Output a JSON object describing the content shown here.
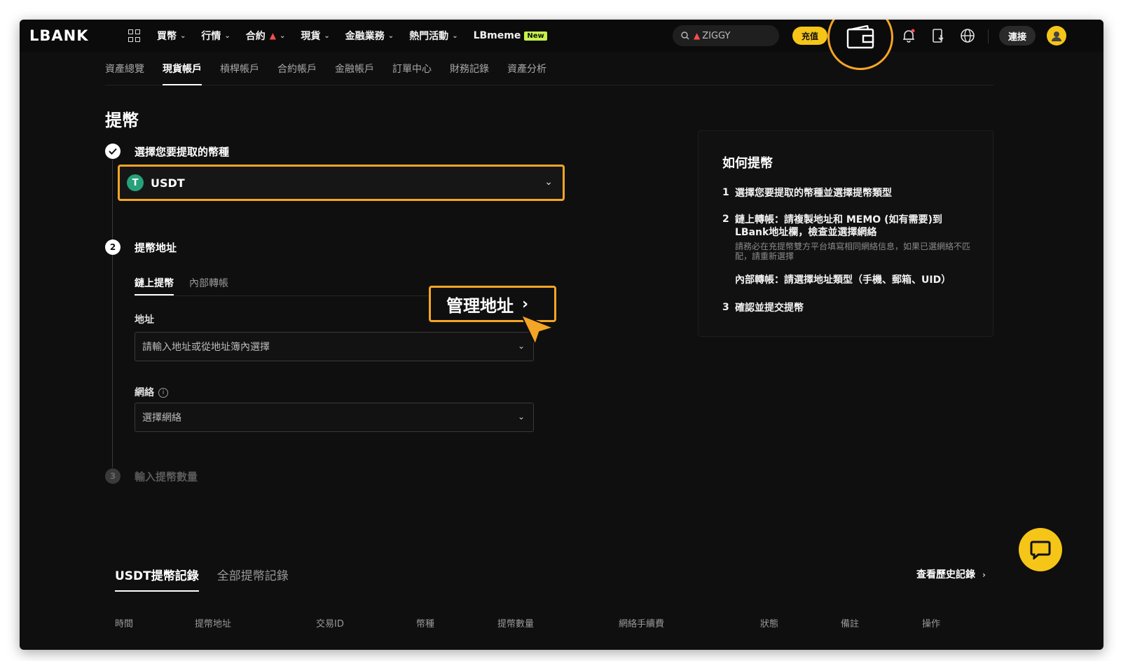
{
  "brand": {
    "logo": "LBANK",
    "accent": "#f5a524",
    "yellow": "#f5c518"
  },
  "topnav": {
    "items": [
      {
        "label": "買幣",
        "has_chevron": true
      },
      {
        "label": "行情",
        "has_chevron": true
      },
      {
        "label": "合約",
        "has_chevron": true,
        "hot": true
      },
      {
        "label": "現貨",
        "has_chevron": true
      },
      {
        "label": "金融業務",
        "has_chevron": true
      },
      {
        "label": "熱門活動",
        "has_chevron": true
      },
      {
        "label": "LBmeme",
        "badge": "New"
      }
    ],
    "search_text": "ZIGGY",
    "deposit_label": "充值",
    "connect_label": "連接",
    "icons": [
      "apps-grid-icon",
      "wallet-icon",
      "bell-icon",
      "download-app-icon",
      "globe-icon",
      "avatar"
    ]
  },
  "subnav": {
    "tabs": [
      "資產總覽",
      "現貨帳戶",
      "槓桿帳戶",
      "合約帳戶",
      "金融帳戶",
      "訂單中心",
      "財務記錄",
      "資產分析"
    ],
    "active_index": 1
  },
  "page": {
    "title": "提幣"
  },
  "steps": {
    "step1": {
      "title": "選擇您要提取的幣種",
      "coin_symbol": "T",
      "coin_name": "USDT",
      "done": true
    },
    "step2": {
      "number": "2",
      "title": "提幣地址",
      "tabs": [
        "鏈上提幣",
        "內部轉帳"
      ],
      "address_label": "地址",
      "address_placeholder": "請輸入地址或從地址簿內選擇",
      "network_label": "網絡",
      "network_placeholder": "選擇網絡",
      "manage_address_label": "管理地址"
    },
    "step3": {
      "number": "3",
      "title": "輸入提幣數量"
    }
  },
  "howto": {
    "title": "如何提幣",
    "items": [
      {
        "num": "1",
        "text": "選擇您要提取的幣種並選擇提幣類型"
      },
      {
        "num": "2",
        "text": "鏈上轉帳：請複製地址和 MEMO (如有需要)到LBank地址欄，檢查並選擇網絡",
        "note": "請務必在充提幣雙方平台填寫相同網絡信息，如果已選網絡不匹配，請重新選擇",
        "extra": "內部轉帳：請選擇地址類型（手機、郵箱、UID）"
      },
      {
        "num": "3",
        "text": "確認並提交提幣"
      }
    ]
  },
  "history": {
    "tabs": [
      "USDT提幣記錄",
      "全部提幣記錄"
    ],
    "view_history": "查看歷史記錄",
    "columns": [
      "時間",
      "提幣地址",
      "交易ID",
      "幣種",
      "提幣數量",
      "網絡手續費",
      "狀態",
      "備註",
      "操作"
    ]
  }
}
